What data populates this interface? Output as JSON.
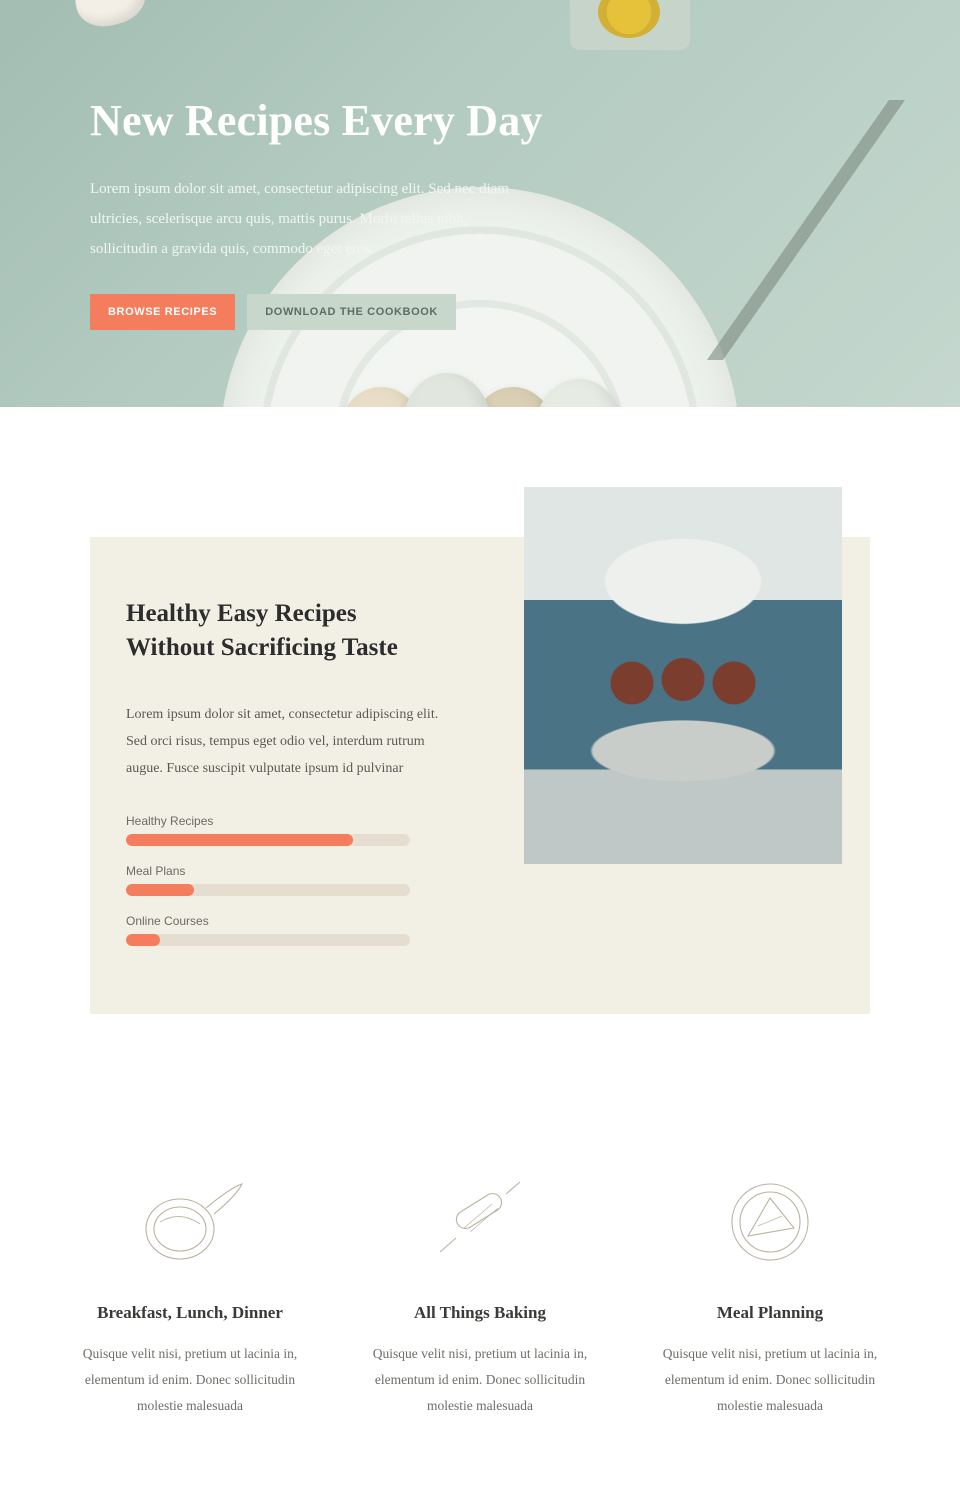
{
  "hero": {
    "title": "New Recipes Every Day",
    "description": "Lorem ipsum dolor sit amet, consectetur adipiscing elit. Sed nec diam ultricies, scelerisque arcu quis, mattis purus. Morbi tellus nibh, sollicitudin a gravida quis, commodo eget eros.",
    "primary_btn": "Browse Recipes",
    "secondary_btn": "Download the Cookbook"
  },
  "about": {
    "title": "Healthy Easy Recipes Without Sacrificing Taste",
    "description": "Lorem ipsum dolor sit amet, consectetur adipiscing elit. Sed orci risus, tempus eget odio vel, interdum rutrum augue. Fusce suscipit vulputate ipsum id pulvinar",
    "bars": [
      {
        "label": "Healthy Recipes",
        "percent": 80
      },
      {
        "label": "Meal Plans",
        "percent": 24
      },
      {
        "label": "Online Courses",
        "percent": 12
      }
    ]
  },
  "features": [
    {
      "title": "Breakfast, Lunch, Dinner",
      "description": "Quisque velit nisi, pretium ut lacinia in, elementum id enim. Donec sollicitudin molestie malesuada"
    },
    {
      "title": "All Things Baking",
      "description": "Quisque velit nisi, pretium ut lacinia in, elementum id enim. Donec sollicitudin molestie malesuada"
    },
    {
      "title": "Meal Planning",
      "description": "Quisque velit nisi, pretium ut lacinia in, elementum id enim. Donec sollicitudin molestie malesuada"
    }
  ]
}
